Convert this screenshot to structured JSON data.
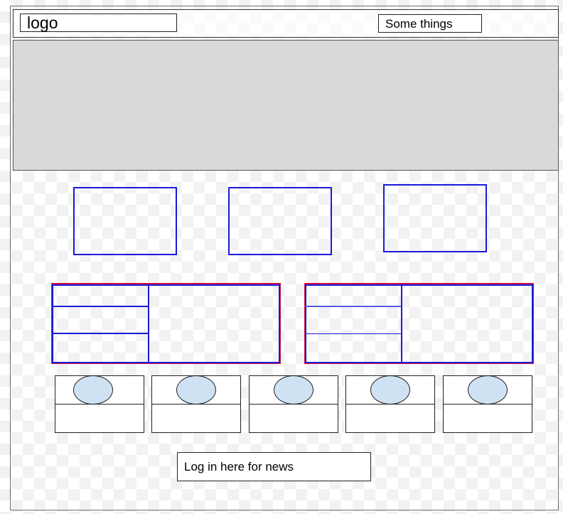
{
  "header": {
    "logo_label": "logo",
    "things_label": "Some things"
  },
  "hero": {},
  "feature_boxes": [
    {},
    {},
    {}
  ],
  "cards": [
    {},
    {}
  ],
  "thumbnails": [
    {},
    {},
    {},
    {},
    {}
  ],
  "login": {
    "label": "Log in here for news"
  },
  "colors": {
    "hero_fill": "#d9d9d9",
    "box_blue": "#1a1adb",
    "card_red": "#d4123e",
    "oval_fill": "#cfe2f3"
  }
}
